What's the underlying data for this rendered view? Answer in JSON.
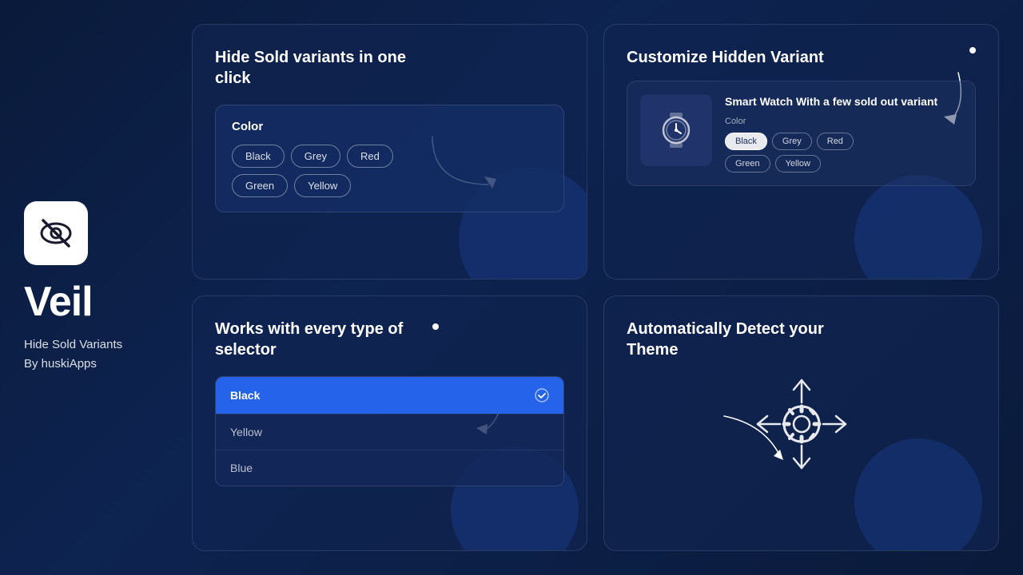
{
  "branding": {
    "logo_alt": "eye-slash-icon",
    "name": "Veil",
    "desc_line1": "Hide Sold Variants",
    "desc_line2": "By huskiApps"
  },
  "card1": {
    "title": "Hide Sold variants in one click",
    "widget_title": "Color",
    "buttons": [
      "Black",
      "Grey",
      "Red",
      "Green",
      "Yellow"
    ]
  },
  "card2": {
    "title": "Customize Hidden Variant",
    "product_name": "Smart Watch With a few sold out variant",
    "color_label": "Color",
    "buttons": [
      "Black",
      "Grey",
      "Red",
      "Green",
      "Yellow"
    ],
    "active_button": "Black"
  },
  "card3": {
    "title": "Works with every type of selector",
    "dropdown_items": [
      {
        "label": "Black",
        "selected": true
      },
      {
        "label": "Yellow",
        "selected": false
      },
      {
        "label": "Blue",
        "selected": false
      }
    ]
  },
  "card4": {
    "title": "Automatically Detect your Theme"
  }
}
